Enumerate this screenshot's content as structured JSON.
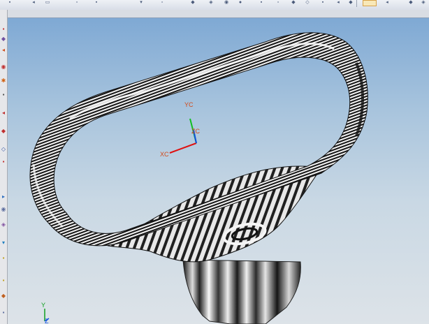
{
  "window": {
    "toolbar_icons": [
      "save-icon",
      "undo-icon",
      "redo-icon",
      "cut-icon",
      "copy-icon",
      "paste-icon",
      "view-icon",
      "fit-icon",
      "zoom-icon",
      "rotate-icon",
      "pan-icon",
      "shade-icon",
      "wireframe-icon",
      "select-icon"
    ],
    "left_toolbar_icons": [
      "history-icon",
      "assembly-icon",
      "part-icon",
      "constraint-icon",
      "feature-icon",
      "sketch-icon",
      "measure-icon",
      "analysis-icon",
      "datum-icon",
      "layer-icon",
      "filter-icon",
      "snap-icon",
      "edit-icon",
      "tool-icon",
      "view-icon",
      "render-icon",
      "help-icon"
    ]
  },
  "viewport": {
    "background_top": "#7fa9d4",
    "background_bottom": "#dde3e8",
    "display_mode": "zebra-stripe analysis",
    "wcs": {
      "x_label": "XC",
      "y_label": "YC",
      "z_label": "ZC",
      "x_color": "#e01010",
      "y_color": "#10c020",
      "z_color": "#1050e0",
      "label_color": "#d24a1a"
    },
    "absolute_triad": {
      "y_label": "Y",
      "z_label": "Z",
      "y_color": "#10a020",
      "z_color": "#1050e0"
    }
  }
}
